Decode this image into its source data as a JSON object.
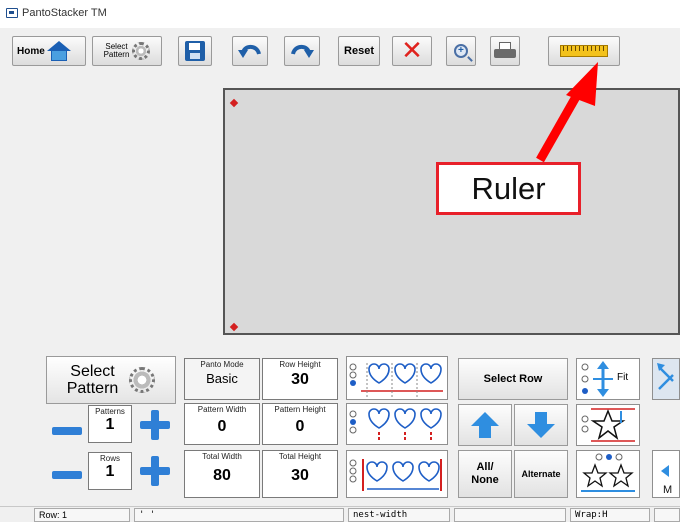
{
  "window": {
    "title": "PantoStacker TM"
  },
  "toolbar": {
    "home_label": "Home",
    "select_label_line1": "Select",
    "select_label_line2": "Pattern",
    "reset_label": "Reset",
    "zoom_symbol": "+"
  },
  "callout": {
    "label": "Ruler"
  },
  "panel": {
    "select_pattern_line1": "Select",
    "select_pattern_line2": "Pattern",
    "patterns_caption": "Patterns",
    "patterns_value": "1",
    "rows_caption": "Rows",
    "rows_value": "1",
    "panto_mode_caption": "Panto Mode",
    "panto_mode_value": "Basic",
    "row_height_caption": "Row Height",
    "row_height_value": "30",
    "pattern_width_caption": "Pattern Width",
    "pattern_width_value": "0",
    "pattern_height_caption": "Pattern Height",
    "pattern_height_value": "0",
    "total_width_caption": "Total Width",
    "total_width_value": "80",
    "total_height_caption": "Total Height",
    "total_height_value": "30",
    "select_row_label": "Select Row",
    "all_none_line1": "All/",
    "all_none_line2": "None",
    "alternate_label": "Alternate",
    "fit_label": "Fit"
  },
  "statusbar": {
    "row": "Row: 1",
    "cell2": "' '",
    "nest": "nest-width",
    "wrap": "Wrap:H"
  },
  "colors": {
    "accent": "#2f7fd6",
    "callout": "#e8202a"
  }
}
